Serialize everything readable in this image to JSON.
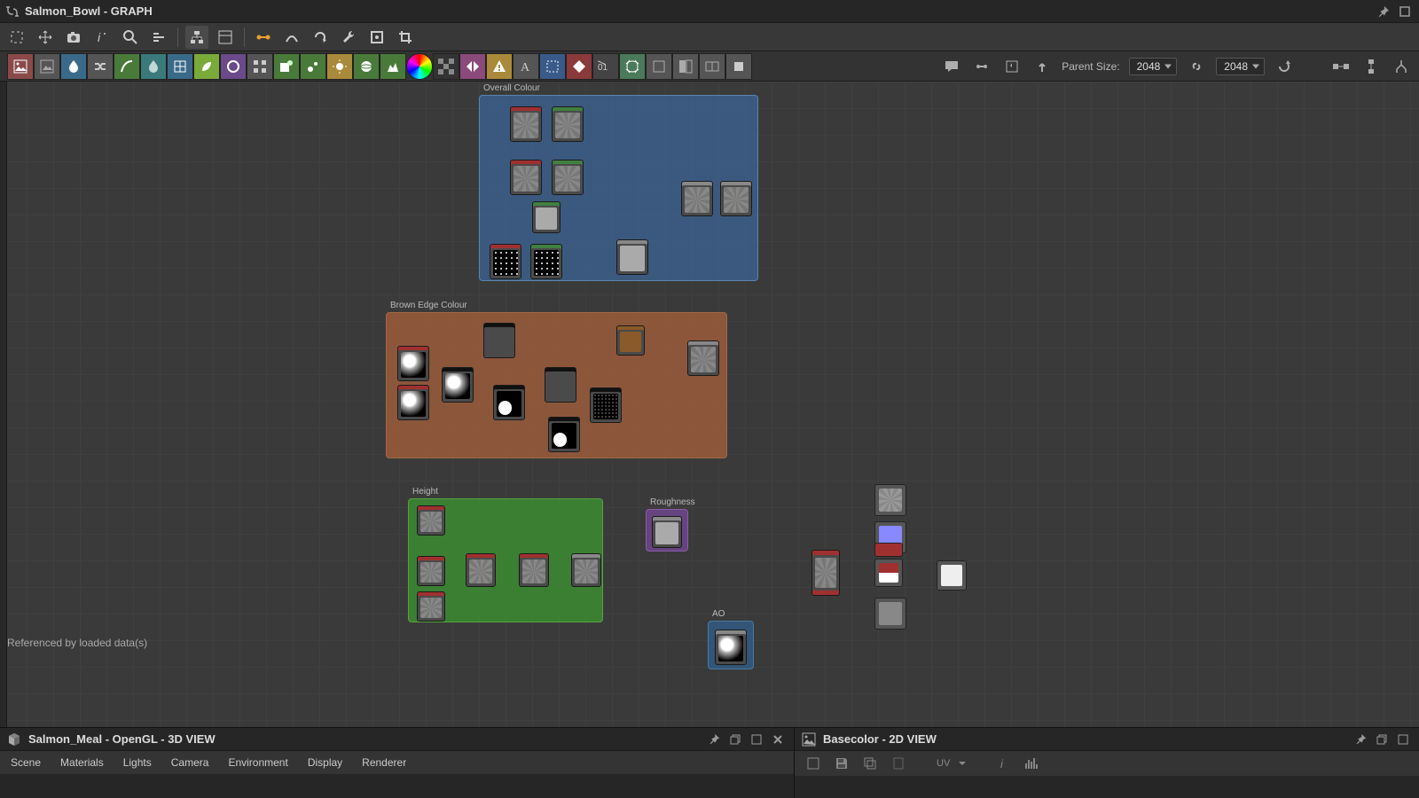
{
  "title": "Salmon_Bowl - GRAPH",
  "status": "Referenced by loaded data(s)",
  "parent_size": {
    "label": "Parent Size:",
    "w": "2048",
    "h": "2048"
  },
  "frames": {
    "overall": "Overall Colour",
    "brown": "Brown Edge Colour",
    "height": "Height",
    "roughness": "Roughness",
    "ao": "AO"
  },
  "panel3d": {
    "title": "Salmon_Meal - OpenGL - 3D VIEW",
    "menu": [
      "Scene",
      "Materials",
      "Lights",
      "Camera",
      "Environment",
      "Display",
      "Renderer"
    ]
  },
  "panel2d": {
    "title": "Basecolor - 2D VIEW",
    "uv_label": "UV"
  }
}
